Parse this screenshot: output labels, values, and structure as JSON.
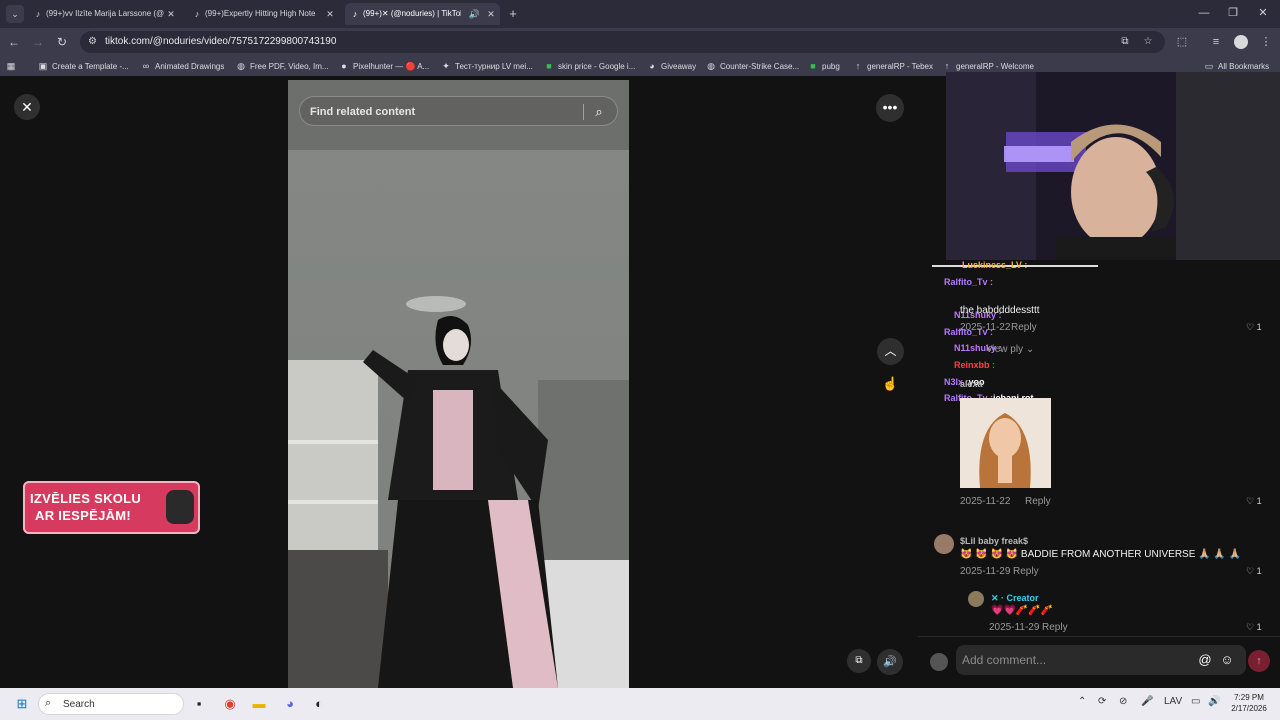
{
  "browser": {
    "tabs": [
      {
        "title": "(99+)‎vv Ilzīte Marija Larssone (@",
        "active": false
      },
      {
        "title": "(99+)Expertly Hitting High Note",
        "active": false
      },
      {
        "title": "(99+)✕ (@noduries) | TikTok",
        "active": true
      }
    ],
    "url": "tiktok.com/@noduries/video/7575172299800743190",
    "bookmarks": [
      {
        "label": "Create a Template -..."
      },
      {
        "label": "Animated Drawings"
      },
      {
        "label": "Free PDF, Video, Im..."
      },
      {
        "label": "Pixelhunter — 🔴 A..."
      },
      {
        "label": "Тест-турнир LV mei..."
      },
      {
        "label": "skin price - Google i..."
      },
      {
        "label": "Giveaway"
      },
      {
        "label": "Counter-Strike Case..."
      },
      {
        "label": "pubg"
      },
      {
        "label": "generalRP - Tebex"
      },
      {
        "label": "generalRP - Welcome"
      }
    ],
    "all_bookmarks": "All Bookmarks"
  },
  "video": {
    "search_placeholder": "Find related content"
  },
  "ad": {
    "line1": "IZVĒLIES SKOLU",
    "line2": "AR IESPĒJĀM!"
  },
  "overlay_chat": [
    {
      "user": "Luckiness_LV :",
      "color": "#f0b030"
    },
    {
      "user": "Ralfito_Tv :",
      "color": "#b878ff"
    },
    {
      "user": "N11shuky :",
      "color": "#b878ff"
    },
    {
      "user": "Ralfito_Tv :",
      "color": "#b878ff"
    },
    {
      "user": "N11shuky :",
      "color": "#b878ff"
    },
    {
      "user": "Reinxbb :",
      "color": "#ff4040"
    },
    {
      "user": "N3lx :",
      "color": "#b878ff",
      "text": "yoo"
    },
    {
      "user": "Ralfito_Tv :",
      "color": "#b878ff",
      "text": "iebani rot"
    }
  ],
  "comments": {
    "c1_text": "the babddddessttt",
    "c1_date": "2025-11-22",
    "c1_like": "1",
    "view_replies": "View",
    "view_replies_tail": "ply",
    "c2_name": "alexa",
    "c2_date": "2025-11-22",
    "c2_like": "1",
    "c3_name": "$Lil baby freak$",
    "c3_text": "😻 😻 😻 😻 BADDIE FROM ANOTHER UNIVERSE 🙏🏼 🙏🏼 🙏🏼",
    "c3_date": "2025-11-29",
    "c3_like": "1",
    "c4_name": "✕ · Creator",
    "c4_text": "💗💗🧨🧨🧨",
    "c4_date": "2025-11-29",
    "c4_like": "1",
    "reply_label": "Reply",
    "add_comment": "Add comment..."
  },
  "taskbar": {
    "search": "Search",
    "lang": "LAV",
    "time": "7:29 PM",
    "date": "2/17/2026"
  },
  "colors": {
    "accent_pink": "#fe2c55",
    "ad_pink": "#d63a5f",
    "creator_cyan": "#2bd4f0"
  }
}
